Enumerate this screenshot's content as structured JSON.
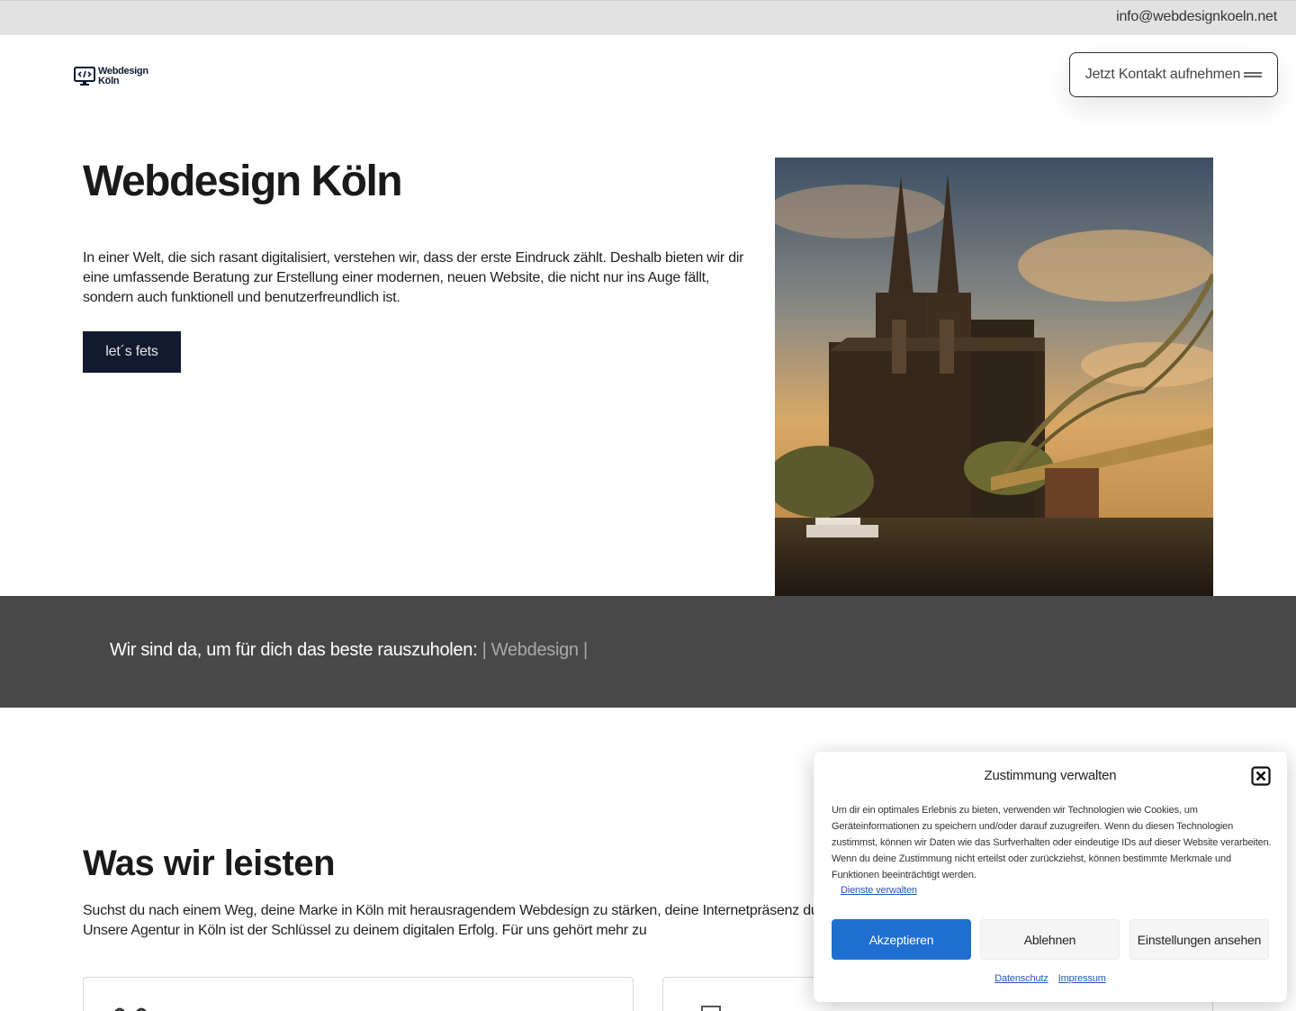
{
  "topbar": {
    "email": "info@webdesignkoeln.net"
  },
  "logo": {
    "line1": "Webdesign",
    "line2": "Köln",
    "icon": "monitor-code-icon"
  },
  "nav": {
    "cta_label": "Jetzt Kontakt aufnehmen",
    "menu_icon": "menu-icon"
  },
  "hero": {
    "title": "Webdesign Köln",
    "text": "In einer Welt, die sich rasant digitalisiert, verstehen wir, dass der erste Eindruck zählt. Deshalb bieten wir dir eine umfassende Beratung zur Erstellung einer modernen, neuen Website, die nicht nur ins Auge fällt, sondern auch funktionell und benutzerfreundlich ist.",
    "button_label": "let´s fets"
  },
  "band": {
    "text": "Wir sind da, um für dich das beste rauszuholen:",
    "highlight": "| Webdesign |"
  },
  "services": {
    "title": "Was wir leisten",
    "text": "Suchst du nach einem Weg, deine Marke in Köln mit herausragendem Webdesign zu stärken, deine Internetpräsenz durch zielgerichtete Online-Marketing-Strategien zu erreichen? Unsere Agentur in Köln ist der Schlüssel zu deinem digitalen Erfolg. Für uns gehört mehr zu"
  },
  "consent": {
    "title": "Zustimmung verwalten",
    "text": "Um dir ein optimales Erlebnis zu bieten, verwenden wir Technologien wie Cookies, um Geräteinformationen zu speichern und/oder darauf zuzugreifen. Wenn du diesen Technologien zustimmst, können wir Daten wie das Surfverhalten oder eindeutige IDs auf dieser Website verarbeiten. Wenn du deine Zustimmung nicht erteilst oder zurückziehst, können bestimmte Merkmale und Funktionen beeinträchtigt werden.",
    "manage_link": "Dienste verwalten",
    "accept": "Akzeptieren",
    "deny": "Ablehnen",
    "settings": "Einstellungen ansehen",
    "privacy_link": "Datenschutz",
    "imprint_link": "Impressum"
  },
  "colors": {
    "accent_dark": "#111a2e",
    "band": "#484848",
    "consent_primary": "#1e6fd0"
  }
}
